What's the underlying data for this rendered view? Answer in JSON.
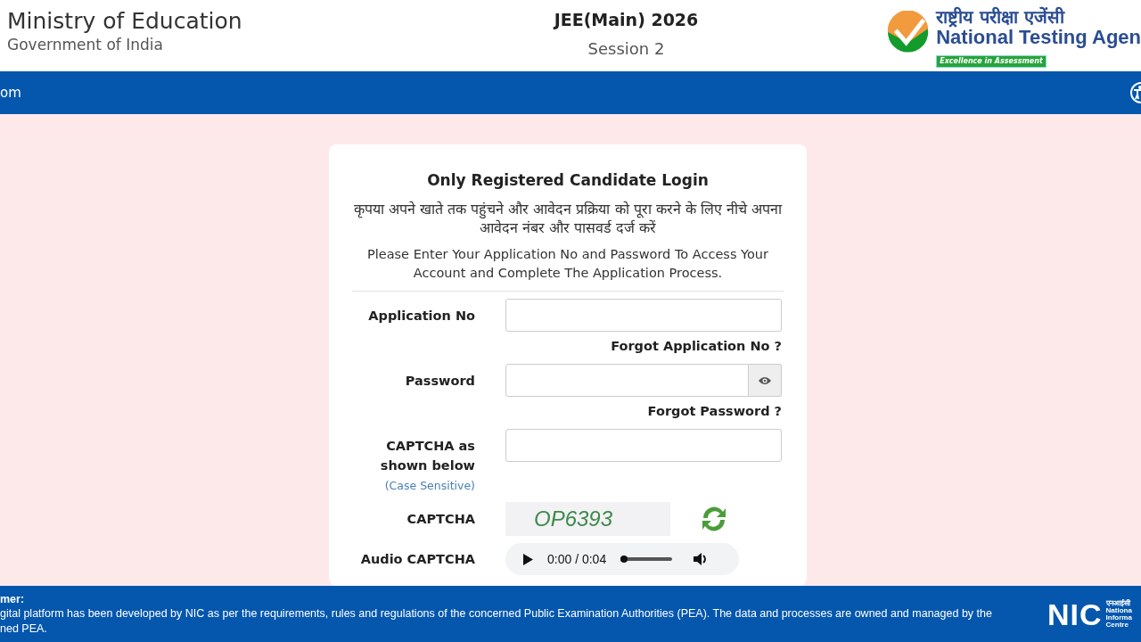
{
  "header": {
    "ministry": {
      "title": "Ministry of Education",
      "subtitle": "Government of India"
    },
    "exam": {
      "title": "JEE(Main) 2026",
      "session": "Session 2"
    },
    "agency": {
      "hindi": "राष्ट्रीय परीक्षा एजेंसी",
      "name": "National Testing Agen",
      "tagline": "Excellence in Assessment"
    }
  },
  "nav": {
    "items": [
      {
        "label": "om"
      }
    ]
  },
  "login": {
    "title": "Only Registered Candidate Login",
    "hindi_instruction": "कृपया अपने खाते तक पहुंचने और आवेदन प्रक्रिया को पूरा करने के लिए नीचे अपना आवेदन नंबर और पासवर्ड दर्ज करें",
    "instruction": "Please Enter Your Application No and Password To Access Your Account and Complete The Application Process.",
    "fields": [
      {
        "kind": "text",
        "label": "Application No",
        "link": "Forgot Application No ?"
      },
      {
        "kind": "password",
        "label": "Password",
        "link": "Forgot Password ?"
      },
      {
        "kind": "text",
        "label": "CAPTCHA as shown below",
        "note": "(Case Sensitive)"
      },
      {
        "kind": "captcha",
        "label": "CAPTCHA",
        "captcha": "OP6393"
      },
      {
        "kind": "audio",
        "label": "Audio CAPTCHA",
        "time": "0:00 / 0:04",
        "level": 0
      }
    ]
  },
  "footer": {
    "heading": "mer:",
    "lines": [
      "gital platform has been developed by NIC as per the requirements, rules and regulations of the concerned Public Examination Authorities (PEA). The data and processes are owned and managed by the",
      "ned PEA."
    ],
    "logo": {
      "mark": "NIC",
      "lines": [
        "एनआईसी",
        "Nationa",
        "Informa",
        "Centre"
      ]
    }
  }
}
